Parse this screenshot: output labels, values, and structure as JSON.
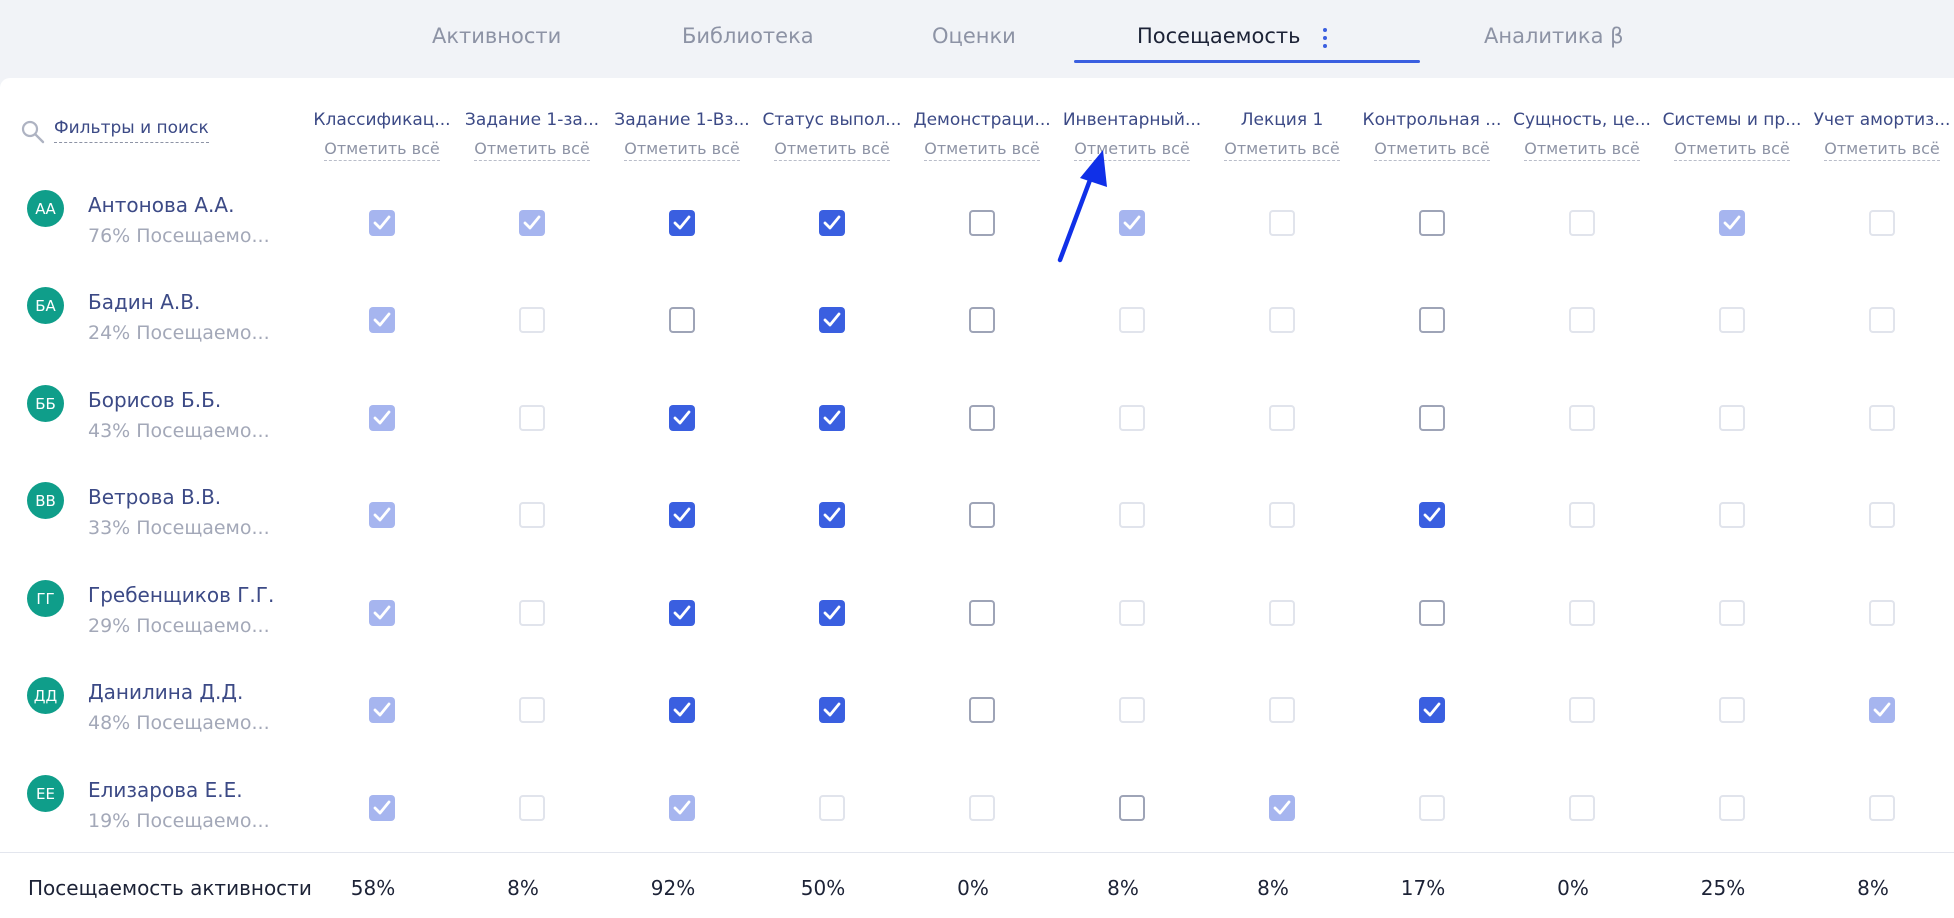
{
  "tabs": [
    {
      "label": "Активности"
    },
    {
      "label": "Библиотека"
    },
    {
      "label": "Оценки"
    },
    {
      "label": "Посещаемость"
    },
    {
      "label": "Аналитика β"
    }
  ],
  "active_tab": "Посещаемость",
  "search": {
    "label": "Фильтры и поиск",
    "icon": "search-icon"
  },
  "mark_all_label": "Отметить всё",
  "columns": [
    {
      "title": "Классификац..."
    },
    {
      "title": "Задание 1-за..."
    },
    {
      "title": "Задание 1-Вз..."
    },
    {
      "title": "Статус выпол..."
    },
    {
      "title": "Демонстраци..."
    },
    {
      "title": "Инвентарный..."
    },
    {
      "title": "Лекция 1"
    },
    {
      "title": "Контрольная ..."
    },
    {
      "title": "Сущность, це..."
    },
    {
      "title": "Системы и пр..."
    },
    {
      "title": "Учет амортиз..."
    }
  ],
  "students": [
    {
      "initials": "АА",
      "name": "Антонова А.А.",
      "attendance": "76% Посещаемо...",
      "marks": [
        "on-dim",
        "on-dim",
        "on",
        "on",
        "off",
        "on-dim",
        "off-dim",
        "off",
        "off-dim",
        "on-dim",
        "off-dim"
      ]
    },
    {
      "initials": "БА",
      "name": "Бадин А.В.",
      "attendance": "24% Посещаемо...",
      "marks": [
        "on-dim",
        "off-dim",
        "off",
        "on",
        "off",
        "off-dim",
        "off-dim",
        "off",
        "off-dim",
        "off-dim",
        "off-dim"
      ]
    },
    {
      "initials": "ББ",
      "name": "Борисов Б.Б.",
      "attendance": "43% Посещаемо...",
      "marks": [
        "on-dim",
        "off-dim",
        "on",
        "on",
        "off",
        "off-dim",
        "off-dim",
        "off",
        "off-dim",
        "off-dim",
        "off-dim"
      ]
    },
    {
      "initials": "ВВ",
      "name": "Ветрова В.В.",
      "attendance": "33% Посещаемо...",
      "marks": [
        "on-dim",
        "off-dim",
        "on",
        "on",
        "off",
        "off-dim",
        "off-dim",
        "on",
        "off-dim",
        "off-dim",
        "off-dim"
      ]
    },
    {
      "initials": "ГГ",
      "name": "Гребенщиков Г.Г.",
      "attendance": "29% Посещаемо...",
      "marks": [
        "on-dim",
        "off-dim",
        "on",
        "on",
        "off",
        "off-dim",
        "off-dim",
        "off",
        "off-dim",
        "off-dim",
        "off-dim"
      ]
    },
    {
      "initials": "ДД",
      "name": "Данилина Д.Д.",
      "attendance": "48% Посещаемо...",
      "marks": [
        "on-dim",
        "off-dim",
        "on",
        "on",
        "off",
        "off-dim",
        "off-dim",
        "on",
        "off-dim",
        "off-dim",
        "on-dim"
      ]
    },
    {
      "initials": "ЕЕ",
      "name": "Елизарова Е.Е.",
      "attendance": "19% Посещаемо...",
      "marks": [
        "on-dim",
        "off-dim",
        "on-dim",
        "off-dim",
        "off-dim",
        "off",
        "on-dim",
        "off-dim",
        "off-dim",
        "off-dim",
        "off-dim"
      ]
    }
  ],
  "footer": {
    "label": "Посещаемость активности",
    "values": [
      "58%",
      "8%",
      "92%",
      "50%",
      "0%",
      "8%",
      "8%",
      "17%",
      "0%",
      "25%",
      "8%"
    ]
  },
  "colors": {
    "accent": "#3a5fe0",
    "avatar": "#0f9e8a",
    "annotation_arrow": "#1030e8"
  }
}
